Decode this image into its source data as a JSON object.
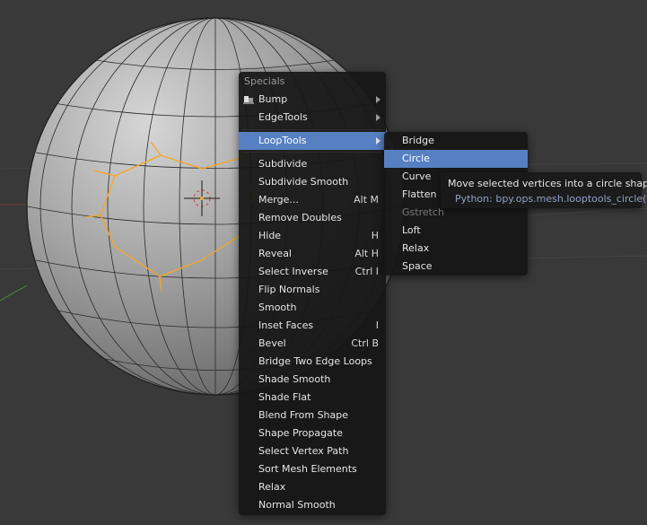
{
  "specials_menu": {
    "title": "Specials",
    "items": [
      {
        "label": "Bump",
        "shortcut": "",
        "submenu": true,
        "icon": "bump-icon"
      },
      {
        "label": "EdgeTools",
        "shortcut": "",
        "submenu": true
      },
      {
        "label": "LoopTools",
        "shortcut": "",
        "submenu": true,
        "active": true
      },
      {
        "label": "Subdivide",
        "shortcut": ""
      },
      {
        "label": "Subdivide Smooth",
        "shortcut": ""
      },
      {
        "label": "Merge...",
        "shortcut": "Alt M"
      },
      {
        "label": "Remove Doubles",
        "shortcut": ""
      },
      {
        "label": "Hide",
        "shortcut": "H"
      },
      {
        "label": "Reveal",
        "shortcut": "Alt H"
      },
      {
        "label": "Select Inverse",
        "shortcut": "Ctrl I"
      },
      {
        "label": "Flip Normals",
        "shortcut": ""
      },
      {
        "label": "Smooth",
        "shortcut": ""
      },
      {
        "label": "Inset Faces",
        "shortcut": "I"
      },
      {
        "label": "Bevel",
        "shortcut": "Ctrl B"
      },
      {
        "label": "Bridge Two Edge Loops",
        "shortcut": ""
      },
      {
        "label": "Shade Smooth",
        "shortcut": ""
      },
      {
        "label": "Shade Flat",
        "shortcut": ""
      },
      {
        "label": "Blend From Shape",
        "shortcut": ""
      },
      {
        "label": "Shape Propagate",
        "shortcut": ""
      },
      {
        "label": "Select Vertex Path",
        "shortcut": ""
      },
      {
        "label": "Sort Mesh Elements",
        "shortcut": ""
      },
      {
        "label": "Relax",
        "shortcut": ""
      },
      {
        "label": "Normal Smooth",
        "shortcut": ""
      }
    ]
  },
  "looptools_submenu": {
    "items": [
      {
        "label": "Bridge"
      },
      {
        "label": "Circle",
        "active": true
      },
      {
        "label": "Curve"
      },
      {
        "label": "Flatten"
      },
      {
        "label": "Gstretch",
        "disabled": true
      },
      {
        "label": "Loft"
      },
      {
        "label": "Relax"
      },
      {
        "label": "Space"
      }
    ]
  },
  "tooltip": {
    "text": "Move selected vertices into a circle shape",
    "python": "Python: bpy.ops.mesh.looptools_circle()"
  },
  "colors": {
    "background": "#393939",
    "highlight": "#5680c2",
    "selection_edges": "#f5a623"
  }
}
